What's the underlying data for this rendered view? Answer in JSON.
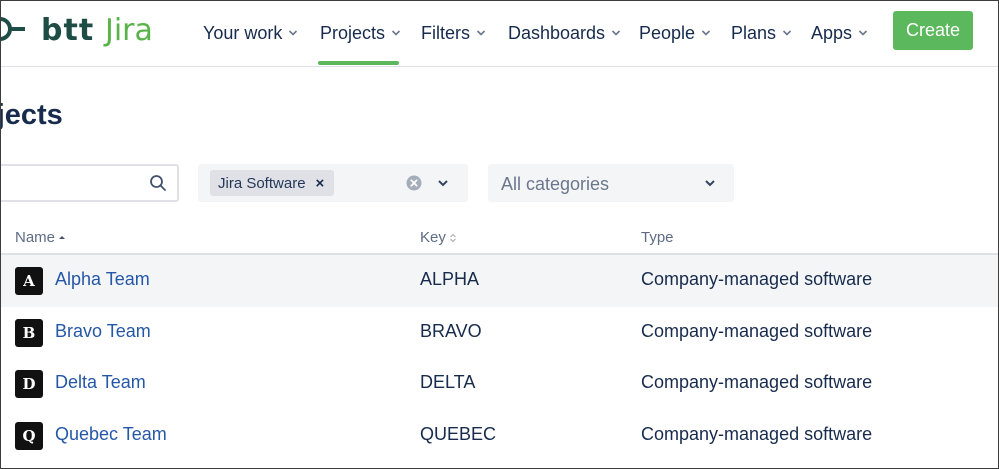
{
  "brand": {
    "prefix": "btt",
    "product": "Jira"
  },
  "nav": {
    "items": [
      {
        "label": "Your work",
        "active": false
      },
      {
        "label": "Projects",
        "active": true
      },
      {
        "label": "Filters",
        "active": false
      },
      {
        "label": "Dashboards",
        "active": false
      },
      {
        "label": "People",
        "active": false
      },
      {
        "label": "Plans",
        "active": false
      },
      {
        "label": "Apps",
        "active": false
      }
    ],
    "create_label": "Create"
  },
  "page": {
    "title": "ojects"
  },
  "filters": {
    "search": {
      "value": "",
      "placeholder": ""
    },
    "product_tag": "Jira Software",
    "product_tag_remove": "×",
    "category_placeholder": "All categories"
  },
  "table": {
    "columns": [
      "Name",
      "Key",
      "Type"
    ],
    "rows": [
      {
        "avatar": "A",
        "name": "Alpha Team",
        "key": "ALPHA",
        "type": "Company-managed software"
      },
      {
        "avatar": "B",
        "name": "Bravo Team",
        "key": "BRAVO",
        "type": "Company-managed software"
      },
      {
        "avatar": "D",
        "name": "Delta Team",
        "key": "DELTA",
        "type": "Company-managed software"
      },
      {
        "avatar": "Q",
        "name": "Quebec Team",
        "key": "QUEBEC",
        "type": "Company-managed software"
      }
    ]
  },
  "colors": {
    "accent": "#5cb85c",
    "link": "#2557a7",
    "text": "#172b4d",
    "logo_dark": "#1e4d45",
    "logo_green": "#59b34a"
  },
  "icons": {
    "search": "search-icon",
    "clear": "clear-circle-icon",
    "chevron": "chevron-down-icon",
    "sort": "sort-icon"
  }
}
